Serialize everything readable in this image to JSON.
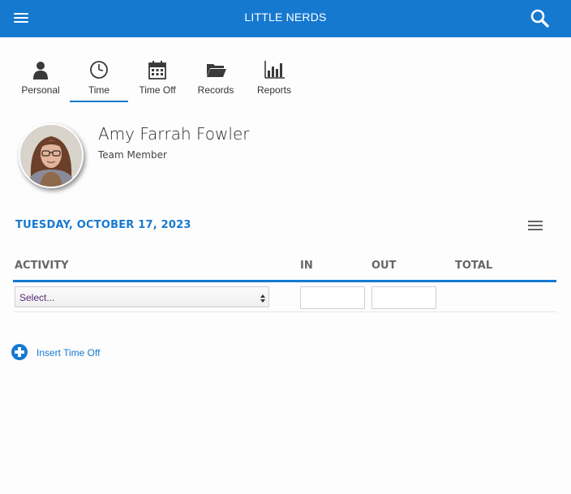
{
  "header": {
    "title": "LITTLE NERDS",
    "menu_icon": "hamburger-menu-icon",
    "search_icon": "search-icon",
    "color": "#1679d0"
  },
  "tabs": [
    {
      "label": "Personal",
      "icon": "person-icon",
      "active": false
    },
    {
      "label": "Time",
      "icon": "clock-icon",
      "active": true
    },
    {
      "label": "Time Off",
      "icon": "calendar-icon",
      "active": false
    },
    {
      "label": "Records",
      "icon": "folder-icon",
      "active": false
    },
    {
      "label": "Reports",
      "icon": "bar-chart-icon",
      "active": false
    }
  ],
  "profile": {
    "name": "Amy Farrah Fowler",
    "role": "Team Member",
    "avatar": "avatar-photo"
  },
  "timesheet": {
    "date": "TUESDAY, OCTOBER 17, 2023",
    "columns": [
      "ACTIVITY",
      "IN",
      "OUT",
      "TOTAL"
    ],
    "rows": [
      {
        "activity": "Select...",
        "in": "",
        "out": "",
        "total": ""
      }
    ],
    "insert_label": "Insert Time Off"
  }
}
